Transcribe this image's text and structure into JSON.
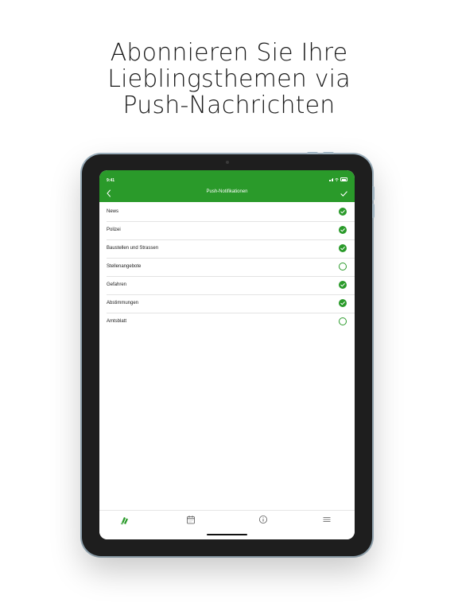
{
  "headline": {
    "line1": "Abonnieren Sie Ihre",
    "line2": "Lieblingsthemen via",
    "line3": "Push-Nachrichten"
  },
  "colors": {
    "accent": "#2a9a2a",
    "text": "#1a1a1a"
  },
  "status_bar": {
    "time": "9:41"
  },
  "nav": {
    "title": "Push-Notifikationen",
    "back_icon": "chevron-left-icon",
    "done_icon": "checkmark-icon"
  },
  "topics": [
    {
      "label": "News",
      "subscribed": true
    },
    {
      "label": "Polizei",
      "subscribed": true
    },
    {
      "label": "Baustellen und Strassen",
      "subscribed": true
    },
    {
      "label": "Stellenangebote",
      "subscribed": false
    },
    {
      "label": "Gefahren",
      "subscribed": true
    },
    {
      "label": "Abstimmungen",
      "subscribed": true
    },
    {
      "label": "Amtsblatt",
      "subscribed": false
    }
  ],
  "tabs": [
    {
      "icon": "news-icon",
      "active": true
    },
    {
      "icon": "calendar-icon",
      "active": false
    },
    {
      "icon": "info-icon",
      "active": false
    },
    {
      "icon": "menu-icon",
      "active": false
    }
  ]
}
